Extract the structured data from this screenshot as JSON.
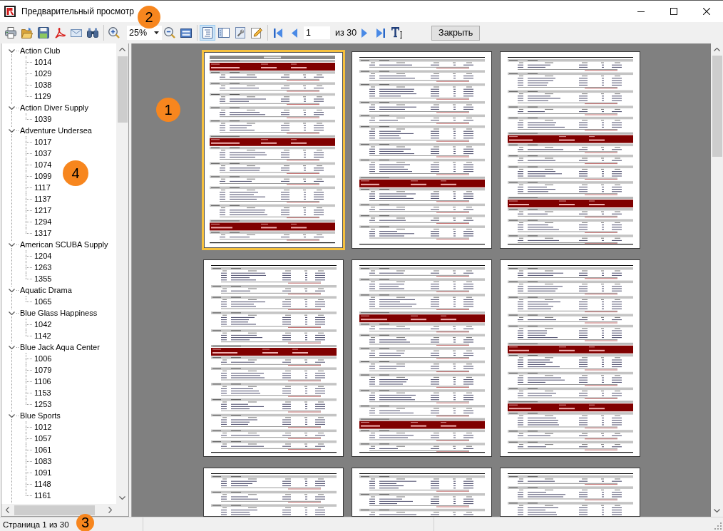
{
  "window": {
    "title": "Предварительный просмотр"
  },
  "toolbar": {
    "callout": "2",
    "items": [
      {
        "kind": "print"
      },
      {
        "kind": "open"
      },
      {
        "kind": "save"
      },
      {
        "kind": "pdf"
      },
      {
        "kind": "email"
      },
      {
        "kind": "find"
      },
      {
        "kind": "separator"
      },
      {
        "kind": "zoomin"
      },
      {
        "kind": "combo",
        "value": "25%"
      },
      {
        "kind": "zoomout"
      },
      {
        "kind": "pageview"
      },
      {
        "kind": "separator"
      },
      {
        "kind": "outline",
        "selected": true
      },
      {
        "kind": "sidepanel",
        "selected": false
      },
      {
        "kind": "setup"
      },
      {
        "kind": "edit"
      },
      {
        "kind": "separator"
      },
      {
        "kind": "first"
      },
      {
        "kind": "prev"
      },
      {
        "kind": "field",
        "value": "1"
      },
      {
        "kind": "label",
        "text": "из 30"
      },
      {
        "kind": "next"
      },
      {
        "kind": "last"
      },
      {
        "kind": "texttool"
      },
      {
        "kind": "button",
        "label": "Закрыть"
      }
    ]
  },
  "sidebar": {
    "callout": "4",
    "tree": [
      {
        "label": "Action Club",
        "expanded": true,
        "children": [
          {
            "label": "1014"
          },
          {
            "label": "1029"
          },
          {
            "label": "1038"
          },
          {
            "label": "1129"
          }
        ]
      },
      {
        "label": "Action Diver Supply",
        "expanded": true,
        "children": [
          {
            "label": "1039"
          }
        ]
      },
      {
        "label": "Adventure Undersea",
        "expanded": true,
        "children": [
          {
            "label": "1017"
          },
          {
            "label": "1037"
          },
          {
            "label": "1074"
          },
          {
            "label": "1099"
          },
          {
            "label": "1117"
          },
          {
            "label": "1137"
          },
          {
            "label": "1217"
          },
          {
            "label": "1294"
          },
          {
            "label": "1317"
          }
        ]
      },
      {
        "label": "American SCUBA Supply",
        "expanded": true,
        "children": [
          {
            "label": "1204"
          },
          {
            "label": "1263"
          },
          {
            "label": "1355"
          }
        ]
      },
      {
        "label": "Aquatic Drama",
        "expanded": true,
        "children": [
          {
            "label": "1065"
          }
        ]
      },
      {
        "label": "Blue Glass Happiness",
        "expanded": true,
        "children": [
          {
            "label": "1042"
          },
          {
            "label": "1142"
          }
        ]
      },
      {
        "label": "Blue Jack Aqua Center",
        "expanded": true,
        "children": [
          {
            "label": "1006"
          },
          {
            "label": "1079"
          },
          {
            "label": "1106"
          },
          {
            "label": "1153"
          },
          {
            "label": "1253"
          }
        ]
      },
      {
        "label": "Blue Sports",
        "expanded": true,
        "children": [
          {
            "label": "1012"
          },
          {
            "label": "1057"
          },
          {
            "label": "1061"
          },
          {
            "label": "1083"
          },
          {
            "label": "1091"
          },
          {
            "label": "1148"
          },
          {
            "label": "1161"
          }
        ]
      }
    ]
  },
  "preview": {
    "callout": "1",
    "pages": [
      {
        "selected": true
      },
      {
        "selected": false
      },
      {
        "selected": false
      },
      {
        "selected": false
      },
      {
        "selected": false
      },
      {
        "selected": false
      },
      {
        "selected": false
      },
      {
        "selected": false
      },
      {
        "selected": false
      }
    ]
  },
  "status_bar": {
    "text": "Страница 1 из 30",
    "callout": "3"
  }
}
